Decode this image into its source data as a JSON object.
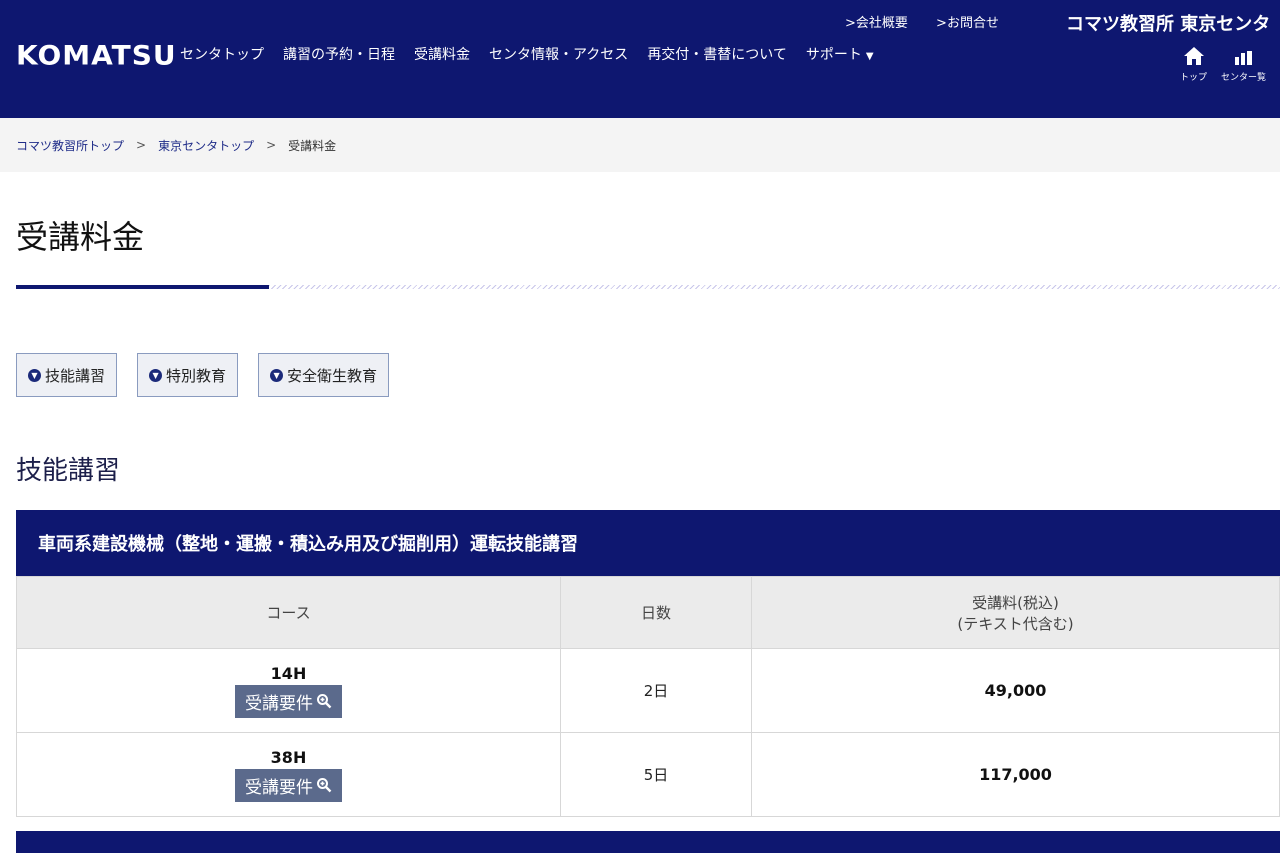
{
  "header": {
    "logo": "KOMATSU",
    "nav": [
      "センタトップ",
      "講習の予約・日程",
      "受講料金",
      "センタ情報・アクセス",
      "再交付・書替について",
      "サポート"
    ],
    "top_links": [
      ">会社概要",
      ">お問合せ"
    ],
    "center_name": "コマツ教習所 東京センタ",
    "icon_labels": {
      "home": "トップ",
      "centers": "センター覧"
    }
  },
  "breadcrumb": {
    "items": [
      "コマツ教習所トップ",
      "東京センタトップ",
      "受講料金"
    ],
    "separator": ">"
  },
  "page": {
    "title": "受講料金",
    "anchors": [
      "技能講習",
      "特別教育",
      "安全衛生教育"
    ],
    "section_title": "技能講習"
  },
  "course": {
    "heading": "車両系建設機械（整地・運搬・積込み用及び掘削用）運転技能講習",
    "columns": {
      "course": "コース",
      "days": "日数",
      "fee_line1": "受講料(税込)",
      "fee_line2": "(テキスト代含む)"
    },
    "requirements_label": "受講要件",
    "rows": [
      {
        "course": "14H",
        "days": "2日",
        "fee": "49,000"
      },
      {
        "course": "38H",
        "days": "5日",
        "fee": "117,000"
      }
    ]
  },
  "colors": {
    "navy": "#0e1770",
    "button": "#5b6a8c"
  }
}
